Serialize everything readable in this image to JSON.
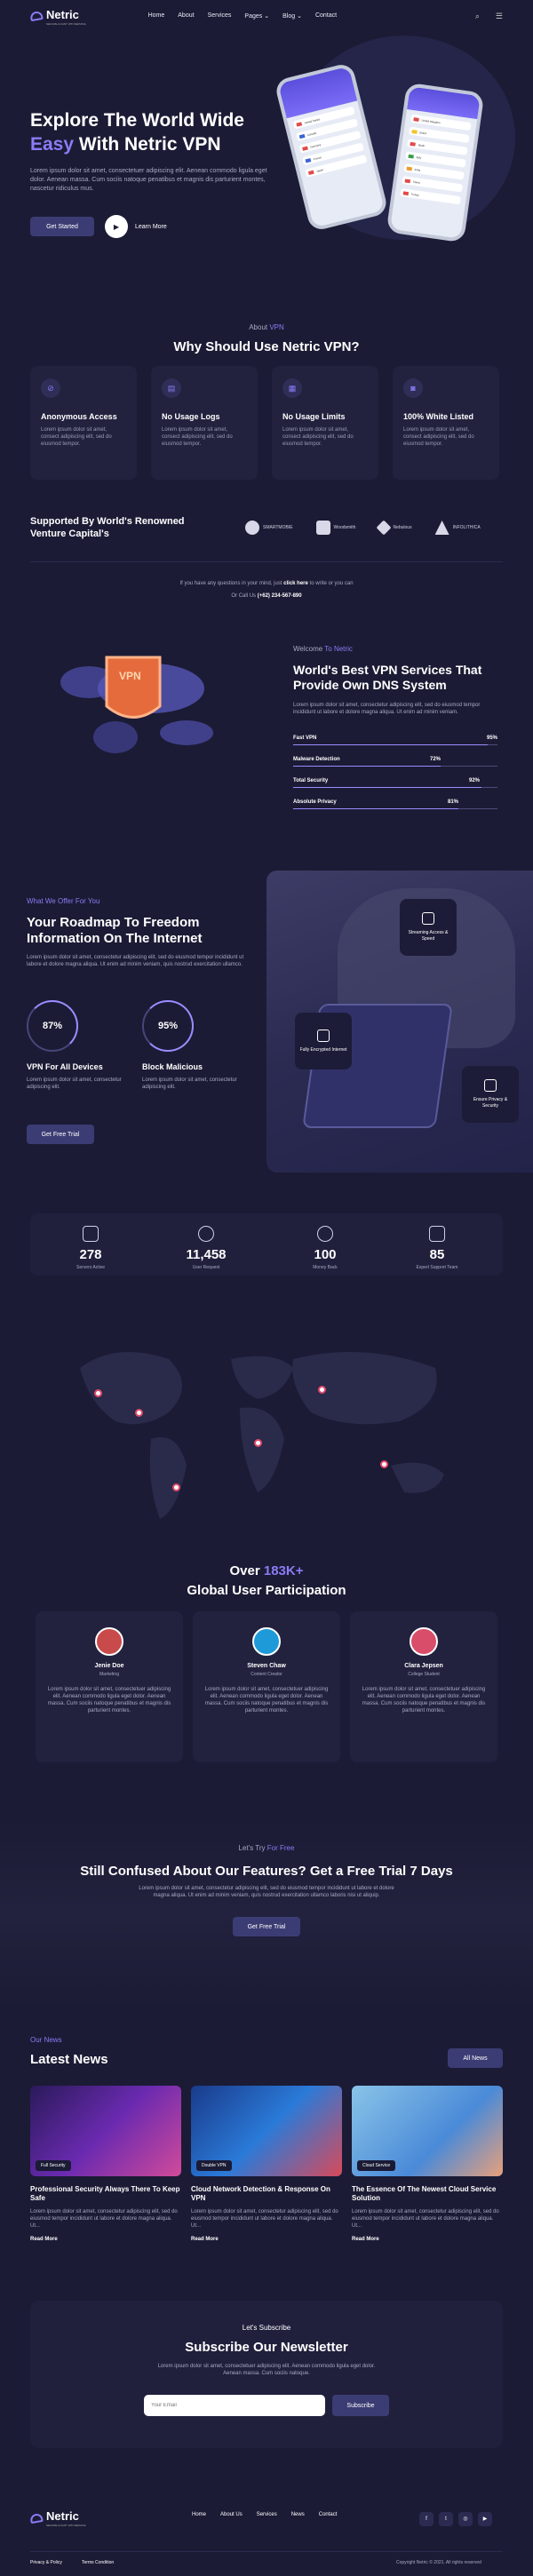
{
  "nav": {
    "brand": "Netric",
    "brand_tagline": "SECURE & FAST VPN SERVICE",
    "items": [
      "Home",
      "About",
      "Services",
      "Pages",
      "Blog",
      "Contact"
    ],
    "pages_caret": "⌄",
    "blog_caret": "⌄",
    "search_glyph": "⌕",
    "menu_glyph": "☰"
  },
  "hero": {
    "title_line1": "Explore The World Wide",
    "title_highlight": "Easy",
    "title_line2_rest": " With Netric VPN",
    "description": "Lorem ipsum dolor sit amet, consectetuer adipiscing elit. Aenean commodo ligula eget dolor. Aenean massa. Cum sociis natoque penatibus et magnis dis parturient montes, nascetur ridiculus mus.",
    "cta_label": "Get Started",
    "video_label": "Learn More",
    "phone_rows_left": [
      "United States",
      "Canada",
      "Germany",
      "France",
      "Japan"
    ],
    "phone_rows_right": [
      "United Kingdom",
      "Brazil",
      "Spain",
      "Italy",
      "India",
      "China",
      "Turkey"
    ]
  },
  "why": {
    "kicker_prefix": "About",
    "kicker_highlight": "VPN",
    "title": "Why Should Use Netric VPN?",
    "features": [
      {
        "title": "Anonymous Access",
        "desc": "Lorem ipsum dolor sit amet, consect adipiscing elit, sed do eiusmod tempor.",
        "icon": "eye-off-icon"
      },
      {
        "title": "No Usage Logs",
        "desc": "Lorem ipsum dolor sit amet, consect adipiscing elit, sed do eiusmod tempor.",
        "icon": "document-icon"
      },
      {
        "title": "No Usage Limits",
        "desc": "Lorem ipsum dolor sit amet, consect adipiscing elit, sed do eiusmod tempor.",
        "icon": "database-icon"
      },
      {
        "title": "100% White Listed",
        "desc": "Lorem ipsum dolor sit amet, consect adipiscing elit, sed do eiusmod tempor.",
        "icon": "lock-icon"
      }
    ]
  },
  "supported": {
    "title": "Supported By World's Renowned Venture Capital's",
    "brands": [
      "SMARTMOBIE",
      "Woodsmith",
      "Nebulous",
      "INFOLITHICA"
    ]
  },
  "contact_strip": {
    "line1_prefix": "If you have any questions in your mind, just ",
    "line1_link": "click here",
    "line1_suffix": " to write or you can",
    "line2_prefix": "Or Call Us ",
    "phone": "(+62) 234-567-890"
  },
  "dns": {
    "kicker_prefix": "Welcome",
    "kicker_highlight": "To Netric",
    "title": "World's Best VPN Services That Provide Own DNS System",
    "description": "Lorem ipsum dolor sit amet, consectetur adipiscing elit, sed do eiusmod tempor incididunt ut labore et dolore magna aliqua. Ut enim ad minim veniam.",
    "shield_label": "VPN",
    "bars": [
      {
        "label": "Fast VPN",
        "value": 95,
        "text": "95%"
      },
      {
        "label": "Malware Detection",
        "value": 72,
        "text": "72%"
      },
      {
        "label": "Total Security",
        "value": 92,
        "text": "92%"
      },
      {
        "label": "Absolute Privacy",
        "value": 81,
        "text": "81%"
      }
    ]
  },
  "offer": {
    "kicker_prefix": "What We",
    "kicker_highlight": "Offer For You",
    "title": "Your Roadmap To Freedom Information On The Internet",
    "description": "Lorem ipsum dolor sit amet, consectetur adipiscing elit, sed do eiusmod tempor incididunt ut labore et dolore magna aliqua. Ut enim ad minim veniam, quis nostrud exercitation ullamco.",
    "circles": [
      {
        "value": 87,
        "text": "87%",
        "title": "VPN For All Devices",
        "desc": "Lorem ipsum dolor sit amet, consectetur adipiscing elit."
      },
      {
        "value": 95,
        "text": "95%",
        "title": "Block Malicious",
        "desc": "Lorem ipsum dolor sit amet, consectetur adipiscing elit."
      }
    ],
    "cta_label": "Get Free Trial",
    "badges": [
      "Streaming Access & Speed",
      "Fully Encrypted Internet",
      "Ensure Privacy & Security"
    ]
  },
  "stats": [
    {
      "num": "278",
      "label": "Servers Active",
      "icon": "server-icon"
    },
    {
      "num": "11,458",
      "label": "User Request",
      "icon": "globe-icon"
    },
    {
      "num": "100",
      "label": "Money Back",
      "icon": "dollar-icon"
    },
    {
      "num": "85",
      "label": "Expert Support Team",
      "icon": "support-icon"
    }
  ],
  "users": {
    "title_prefix": "Over ",
    "title_highlight": "183K+",
    "title_line2": "Global User Participation",
    "testimonials": [
      {
        "name": "Jenie Doe",
        "role": "Marketing",
        "text": "Lorem ipsum dolor sit amet, consectetuer adipiscing elit. Aenean commodo ligula eget dolor. Aenean massa. Cum sociis natoque penatibus et magnis dis parturient montes.",
        "avatar_color": "#c94a4a"
      },
      {
        "name": "Steven Chaw",
        "role": "Content Creator",
        "text": "Lorem ipsum dolor sit amet, consectetuer adipiscing elit. Aenean commodo ligula eget dolor. Aenean massa. Cum sociis natoque penatibus et magnis dis parturient montes.",
        "avatar_color": "#1f9ad8"
      },
      {
        "name": "Clara Jepsen",
        "role": "College Student",
        "text": "Lorem ipsum dolor sit amet, consectetuer adipiscing elit. Aenean commodo ligula eget dolor. Aenean massa. Cum sociis natoque penatibus et magnis dis parturient montes.",
        "avatar_color": "#d94c6a"
      }
    ]
  },
  "trial": {
    "kicker_prefix": "Let's Try",
    "kicker_highlight": "For Free",
    "title": "Still Confused About Our Features? Get a Free Trial 7 Days",
    "description": "Lorem ipsum dolor sit amet, consectetur adipiscing elit, sed do eiusmod tempor incididunt ut labore et dolore magna aliqua. Ut enim ad minim veniam, quis nostrud exercitation ullamco laboris nisi ut aliquip.",
    "cta_label": "Get Free Trial"
  },
  "news": {
    "kicker_prefix": "Our",
    "kicker_highlight": "News",
    "title": "Latest News",
    "all_label": "All News",
    "items": [
      {
        "category": "Full Security",
        "title": "Professional Security Always There To Keep Safe",
        "desc": "Lorem ipsum dolor sit amet, consectetur adipiscing elit, sed do eiusmod tempor incididunt ut labore et dolore magna aliqua. Ut...",
        "read": "Read More"
      },
      {
        "category": "Double VPN",
        "title": "Cloud Network Detection & Response On VPN",
        "desc": "Lorem ipsum dolor sit amet, consectetur adipiscing elit, sed do eiusmod tempor incididunt ut labore et dolore magna aliqua. Ut...",
        "read": "Read More"
      },
      {
        "category": "Cloud Service",
        "title": "The Essence Of The Newest Cloud Service Solution",
        "desc": "Lorem ipsum dolor sit amet, consectetur adipiscing elit, sed do eiusmod tempor incididunt ut labore et dolore magna aliqua. Ut...",
        "read": "Read More"
      }
    ]
  },
  "newsletter": {
    "kicker": "Let's Subscribe",
    "title": "Subscribe Our Newsletter",
    "description": "Lorem ipsum dolor sit amet, consectetuer adipiscing elit. Aenean commodo ligula eget dolor. Aenean massa. Cum sociis natoque.",
    "placeholder": "Your Email",
    "button": "Subscribe"
  },
  "footer": {
    "brand": "Netric",
    "brand_tagline": "SECURE & FAST VPN SERVICE",
    "links": [
      "Home",
      "About Us",
      "Services",
      "News",
      "Contact"
    ],
    "social_glyphs": [
      "f",
      "t",
      "◎",
      "▶"
    ],
    "privacy": "Privacy & Policy",
    "terms": "Terms Condition",
    "copyright": "Copyright Netric © 2021. All rights reserved"
  }
}
